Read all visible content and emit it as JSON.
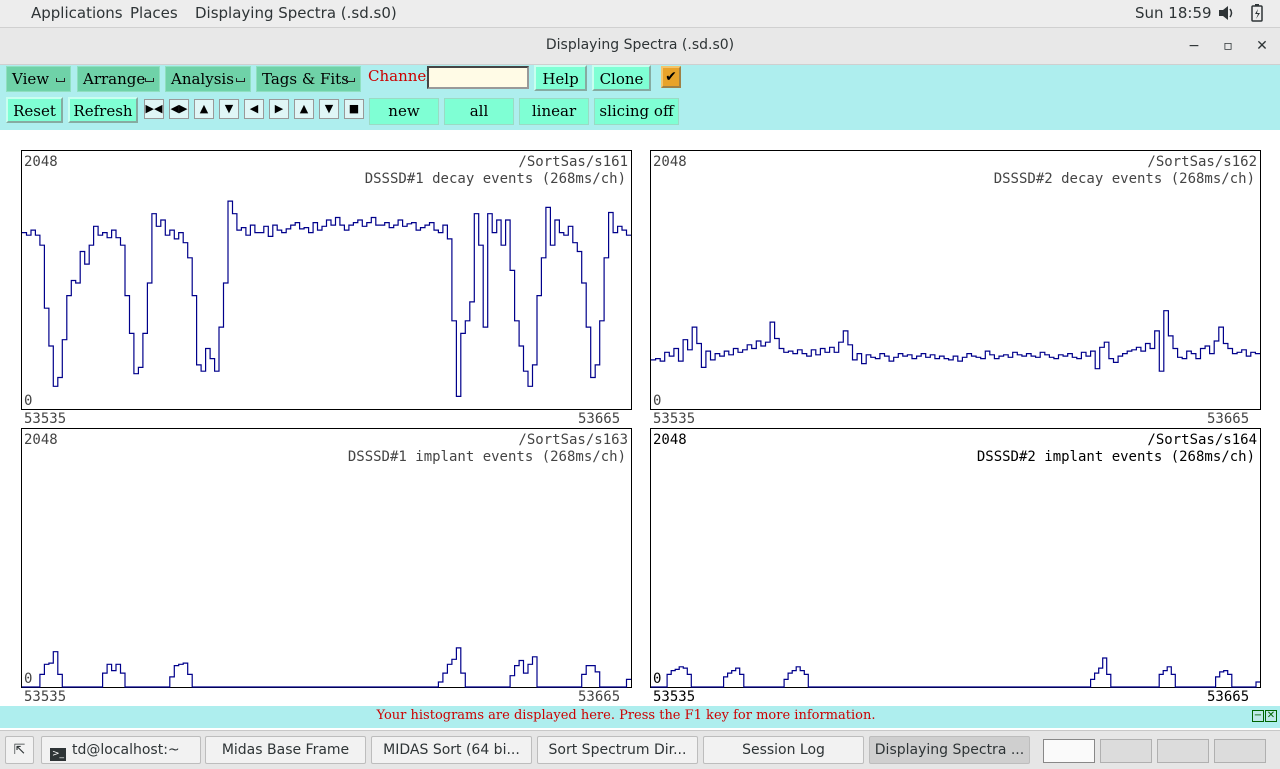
{
  "topbar": {
    "applications": "Applications",
    "places": "Places",
    "window_title": "Displaying Spectra (.sd.s0)",
    "clock": "Sun 18:59"
  },
  "window": {
    "title": "Displaying Spectra (.sd.s0)"
  },
  "toolbar": {
    "menus": [
      "View",
      "Arrange",
      "Analysis",
      "Tags & Fits"
    ],
    "channel_label": "Channel:",
    "channel_value": "",
    "help": "Help",
    "clone": "Clone",
    "reset": "Reset",
    "refresh": "Refresh",
    "new": "new",
    "all": "all",
    "scale": "linear",
    "slicing": "slicing off"
  },
  "spectra": [
    {
      "ymax": "2048",
      "ymin": "0",
      "path": "/SortSas/s161",
      "title": "DSSSD#1 decay events (268ms/ch)",
      "xmin": "53535",
      "xmax": "53665",
      "color": "#00008b",
      "values": [
        1400,
        1380,
        1420,
        1380,
        1300,
        800,
        500,
        180,
        250,
        550,
        900,
        1020,
        1000,
        1250,
        1150,
        1300,
        1450,
        1380,
        1400,
        1360,
        1420,
        1360,
        1300,
        900,
        600,
        280,
        330,
        600,
        1000,
        1550,
        1450,
        1500,
        1380,
        1420,
        1350,
        1400,
        1320,
        1200,
        900,
        350,
        300,
        480,
        400,
        300,
        650,
        1000,
        1650,
        1550,
        1420,
        1440,
        1380,
        1460,
        1400,
        1400,
        1450,
        1370,
        1460,
        1420,
        1400,
        1430,
        1460,
        1480,
        1430,
        1440,
        1400,
        1480,
        1420,
        1450,
        1500,
        1460,
        1520,
        1460,
        1420,
        1460,
        1480,
        1500,
        1450,
        1480,
        1520,
        1460,
        1460,
        1480,
        1440,
        1460,
        1500,
        1450,
        1470,
        1480,
        1420,
        1440,
        1460,
        1480,
        1420,
        1400,
        1460,
        1350,
        700,
        100,
        600,
        700,
        850,
        1550,
        1300,
        650,
        1550,
        1400,
        1500,
        1300,
        1500,
        1100,
        700,
        500,
        300,
        180,
        350,
        900,
        1200,
        1600,
        1300,
        1500,
        1400,
        1380,
        1450,
        1320,
        1250,
        1000,
        650,
        250,
        350,
        700,
        1200,
        1560,
        1400,
        1450,
        1420,
        1380
      ]
    },
    {
      "ymax": "2048",
      "ymin": "0",
      "path": "/SortSas/s162",
      "title": "DSSSD#2 decay events (268ms/ch)",
      "xmin": "53535",
      "xmax": "53665",
      "color": "#00008b",
      "values": [
        390,
        400,
        380,
        450,
        420,
        480,
        380,
        550,
        470,
        650,
        520,
        330,
        460,
        390,
        440,
        420,
        460,
        430,
        480,
        450,
        470,
        510,
        480,
        540,
        500,
        530,
        690,
        560,
        480,
        450,
        460,
        440,
        470,
        440,
        420,
        470,
        430,
        480,
        450,
        490,
        450,
        530,
        620,
        510,
        390,
        440,
        360,
        430,
        410,
        400,
        440,
        420,
        380,
        410,
        440,
        420,
        430,
        400,
        420,
        440,
        410,
        430,
        400,
        420,
        400,
        390,
        420,
        380,
        410,
        440,
        420,
        410,
        400,
        460,
        430,
        400,
        420,
        430,
        410,
        450,
        430,
        420,
        440,
        420,
        410,
        450,
        430,
        410,
        400,
        430,
        420,
        440,
        410,
        400,
        450,
        420,
        460,
        320,
        490,
        530,
        400,
        370,
        420,
        440,
        460,
        470,
        490,
        460,
        520,
        480,
        620,
        300,
        780,
        580,
        480,
        410,
        400,
        460,
        440,
        400,
        480,
        500,
        440,
        540,
        650,
        520,
        480,
        440,
        450,
        470,
        420,
        450,
        440
      ]
    },
    {
      "ymax": "2048",
      "ymin": "0",
      "path": "/SortSas/s163",
      "title": "DSSSD#1 implant events (268ms/ch)",
      "xmin": "53535",
      "xmax": "53665",
      "color": "#00008b",
      "values": [
        0,
        0,
        0,
        0,
        100,
        180,
        190,
        280,
        100,
        0,
        0,
        0,
        0,
        0,
        0,
        0,
        0,
        0,
        110,
        180,
        130,
        180,
        110,
        0,
        0,
        0,
        0,
        0,
        0,
        0,
        0,
        0,
        0,
        80,
        170,
        180,
        190,
        100,
        0,
        0,
        0,
        0,
        0,
        0,
        0,
        0,
        0,
        0,
        0,
        0,
        0,
        0,
        0,
        0,
        0,
        0,
        0,
        0,
        0,
        0,
        0,
        0,
        0,
        0,
        0,
        0,
        0,
        0,
        0,
        0,
        0,
        0,
        0,
        0,
        0,
        0,
        0,
        0,
        0,
        0,
        0,
        0,
        0,
        0,
        0,
        0,
        0,
        0,
        0,
        0,
        0,
        0,
        0,
        40,
        110,
        180,
        220,
        310,
        110,
        0,
        0,
        0,
        0,
        0,
        0,
        0,
        0,
        0,
        0,
        90,
        170,
        210,
        110,
        180,
        240,
        0,
        0,
        0,
        0,
        0,
        0,
        0,
        0,
        0,
        0,
        100,
        170,
        170,
        120,
        0,
        0,
        0,
        0,
        0,
        0,
        60
      ]
    },
    {
      "ymax": "2048",
      "ymin": "0",
      "path": "/SortSas/s164",
      "title": "DSSSD#2 implant events (268ms/ch)",
      "xmin": "53535",
      "xmax": "53665",
      "color": "#00008b",
      "values": [
        0,
        0,
        0,
        0,
        100,
        130,
        140,
        160,
        150,
        100,
        0,
        0,
        0,
        0,
        0,
        0,
        0,
        0,
        80,
        110,
        130,
        150,
        100,
        0,
        0,
        0,
        0,
        0,
        0,
        0,
        0,
        0,
        0,
        60,
        110,
        130,
        160,
        130,
        100,
        0,
        0,
        0,
        0,
        0,
        0,
        0,
        0,
        0,
        0,
        0,
        0,
        0,
        0,
        0,
        0,
        0,
        0,
        0,
        0,
        0,
        0,
        0,
        0,
        0,
        0,
        0,
        0,
        0,
        0,
        0,
        0,
        0,
        0,
        0,
        0,
        0,
        0,
        0,
        0,
        0,
        0,
        0,
        0,
        0,
        0,
        0,
        0,
        0,
        0,
        0,
        0,
        0,
        0,
        0,
        0,
        0,
        0,
        0,
        0,
        0,
        0,
        0,
        0,
        0,
        0,
        0,
        0,
        0,
        0,
        60,
        110,
        150,
        230,
        100,
        0,
        0,
        0,
        0,
        0,
        0,
        0,
        0,
        0,
        0,
        0,
        0,
        100,
        130,
        160,
        100,
        0,
        0,
        0,
        0,
        0,
        0,
        0,
        0,
        0,
        0,
        80,
        120,
        130,
        100,
        0,
        0,
        0,
        0,
        0,
        0,
        40
      ]
    }
  ],
  "status": {
    "message": "Your histograms are displayed here. Press the F1 key for more information."
  },
  "taskbar": {
    "tasks": [
      "td@localhost:~",
      "Midas Base Frame",
      "MIDAS Sort (64 bi...",
      "Sort Spectrum Dir...",
      "Session Log",
      "Displaying Spectra ..."
    ]
  }
}
